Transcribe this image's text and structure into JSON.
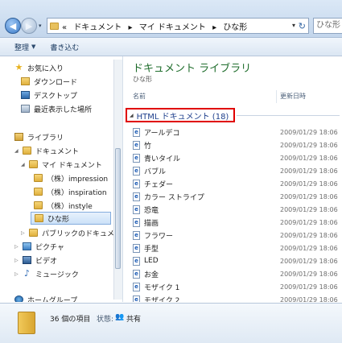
{
  "address": {
    "recent_dropdown": "▾",
    "crumbs": [
      "«",
      "ドキュメント",
      "▸",
      "マイ ドキュメント",
      "▸",
      "ひな形"
    ],
    "dropdown_arrow": "▾",
    "refresh_glyph": "↻"
  },
  "search": {
    "placeholder": "ひな形"
  },
  "toolbar": {
    "organize_label": "整理",
    "burn_label": "書き込む",
    "chevron": "▼"
  },
  "nav": {
    "favorites": "お気に入り",
    "downloads": "ダウンロード",
    "desktop": "デスクトップ",
    "recent": "最近表示した場所",
    "libraries": "ライブラリ",
    "documents": "ドキュメント",
    "my_documents": "マイ ドキュメント",
    "folder_1": "（株）impression",
    "folder_2": "（株）inspiration",
    "folder_3": "（株）instyle",
    "folder_4": "ひな形",
    "public_docs": "パブリックのドキュメン",
    "pictures": "ピクチャ",
    "videos": "ビデオ",
    "music": "ミュージック",
    "homegroup": "ホームグループ"
  },
  "main": {
    "library_title": "ドキュメント ライブラリ",
    "library_subtitle": "ひな形",
    "col_name": "名前",
    "col_date": "更新日時",
    "group_label": "HTML ドキュメント (18)",
    "files": [
      {
        "name": "アールデコ",
        "date": "2009/01/29 18:06"
      },
      {
        "name": "竹",
        "date": "2009/01/29 18:06"
      },
      {
        "name": "青いタイル",
        "date": "2009/01/29 18:06"
      },
      {
        "name": "バブル",
        "date": "2009/01/29 18:06"
      },
      {
        "name": "チェダー",
        "date": "2009/01/29 18:06"
      },
      {
        "name": "カラー ストライプ",
        "date": "2009/01/29 18:06"
      },
      {
        "name": "恐竜",
        "date": "2009/01/29 18:06"
      },
      {
        "name": "描画",
        "date": "2009/01/29 18:06"
      },
      {
        "name": "フラワー",
        "date": "2009/01/29 18:06"
      },
      {
        "name": "手型",
        "date": "2009/01/29 18:06"
      },
      {
        "name": "LED",
        "date": "2009/01/29 18:06"
      },
      {
        "name": "お金",
        "date": "2009/01/29 18:06"
      },
      {
        "name": "モザイク 1",
        "date": "2009/01/29 18:06"
      },
      {
        "name": "モザイク 2",
        "date": "2009/01/29 18:06"
      },
      {
        "name": "音楽",
        "date": "2009/01/29 18:06"
      }
    ]
  },
  "status": {
    "count": "36 個の項目",
    "state_label": "状態:",
    "state_value": "共有"
  }
}
